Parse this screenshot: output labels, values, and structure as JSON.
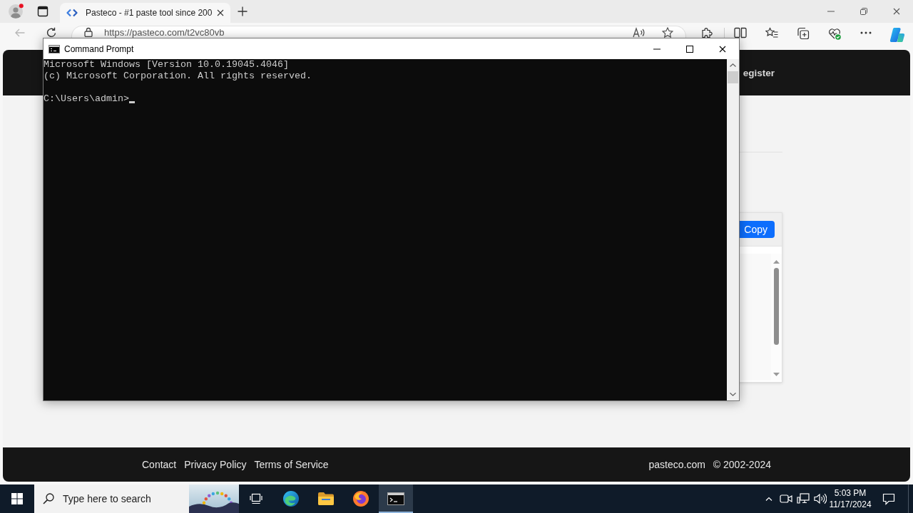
{
  "browser": {
    "tabs": [
      {
        "title": "Pasteco - #1 paste tool since 200",
        "selected": true
      }
    ],
    "back_button": {
      "disabled": true
    },
    "address_bar": {
      "value": "https://pasteco.com/t2vc80vb"
    }
  },
  "page": {
    "header": {
      "links": [
        "egister"
      ]
    },
    "panel": {
      "button": "Copy"
    },
    "footer": {
      "links": [
        "Contact",
        "Privacy Policy",
        "Terms of Service"
      ],
      "site": "pasteco.com",
      "copyright": "© 2002-2024"
    }
  },
  "console_window": {
    "title": "Command Prompt",
    "output": [
      "Microsoft Windows [Version 10.0.19045.4046]",
      "(c) Microsoft Corporation. All rights reserved."
    ],
    "prompt": "C:\\Users\\admin>"
  },
  "taskbar": {
    "search": {
      "placeholder": "Type here to search"
    },
    "apps": [
      {
        "kind": "edge",
        "selected": false
      },
      {
        "kind": "explorer",
        "selected": false
      },
      {
        "kind": "firefox",
        "selected": false
      },
      {
        "kind": "terminal",
        "selected": true
      }
    ],
    "clock": {
      "time": "5:03 PM",
      "date": "11/17/2024"
    }
  }
}
